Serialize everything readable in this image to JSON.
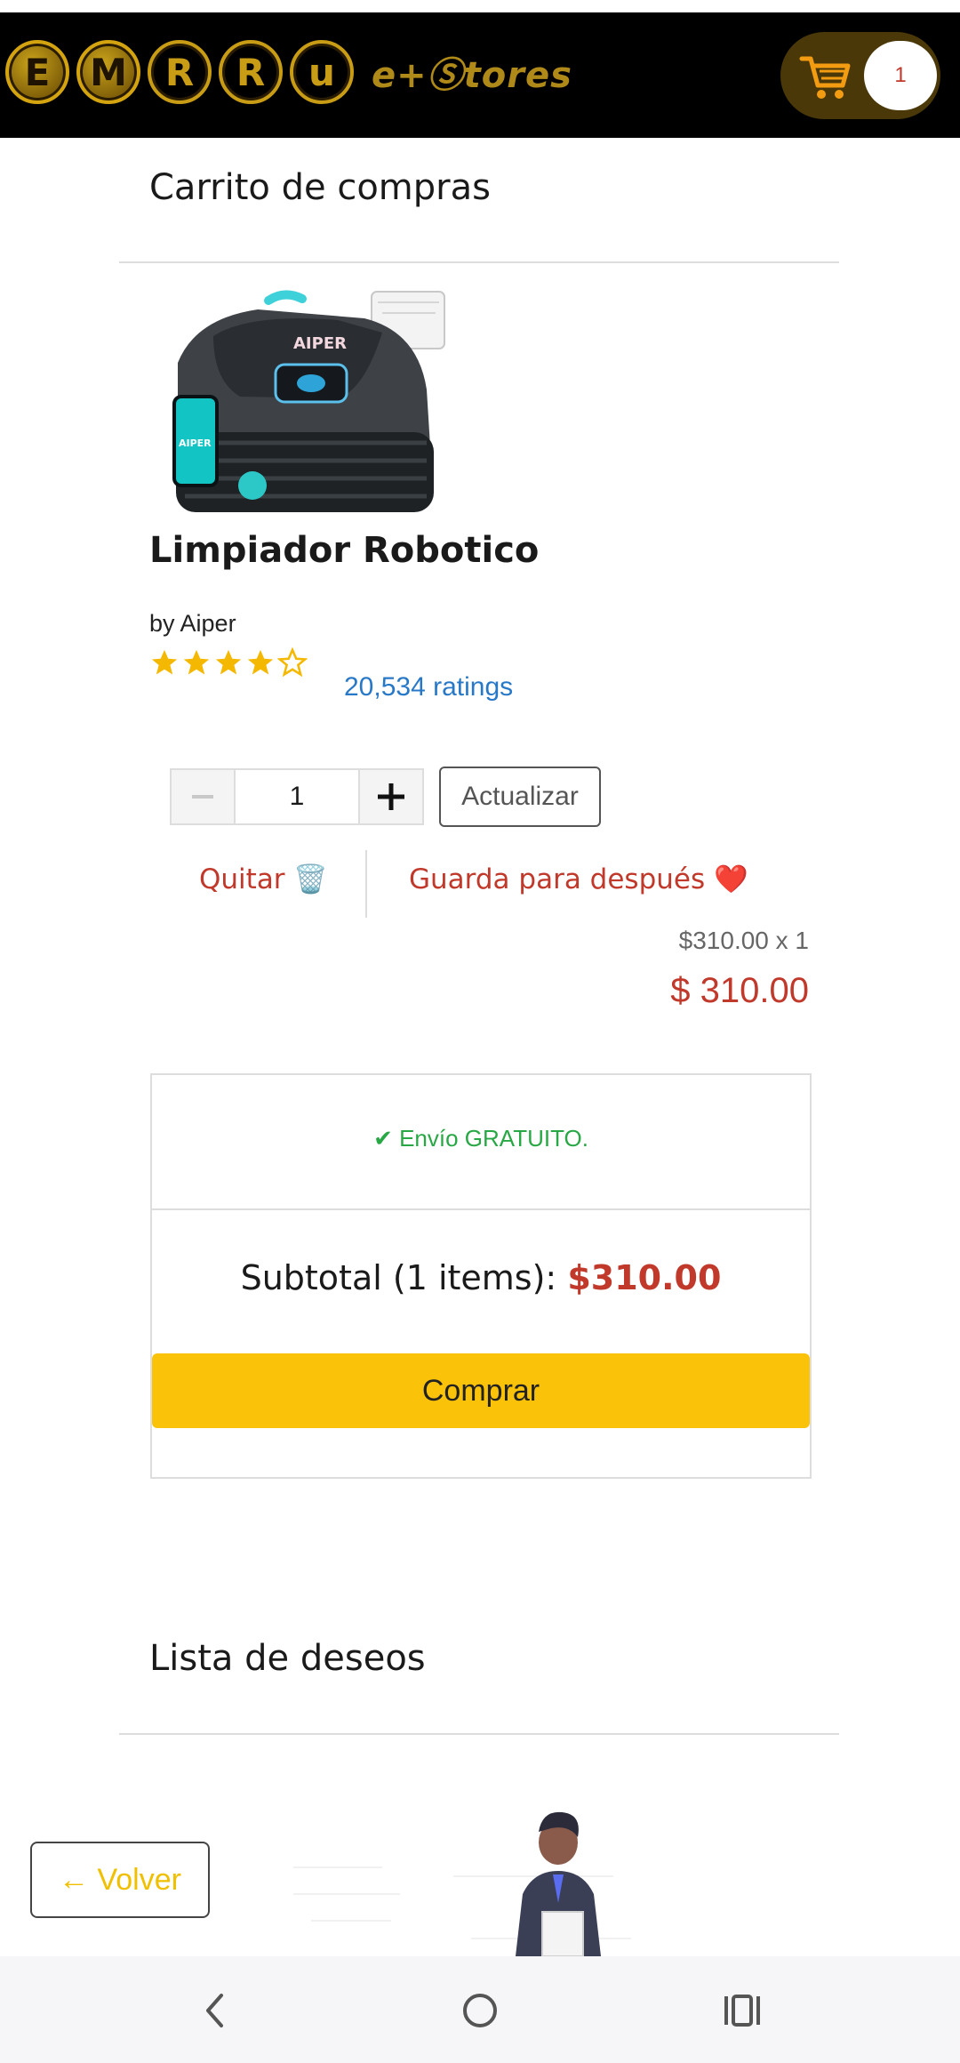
{
  "header": {
    "logo_letters": [
      "E",
      "M",
      "R",
      "R",
      "u"
    ],
    "logo_text": "e+Ⓢtores",
    "cart_count": "1",
    "brand_color": "#c9a21a"
  },
  "cart": {
    "title": "Carrito de compras",
    "product": {
      "name": "Limpiador Robotico",
      "brand": "by Aiper",
      "rating": 4,
      "rating_max": 5,
      "ratings_count": "20,534 ratings",
      "quantity": "1",
      "update_label": "Actualizar",
      "remove_label": "Quitar 🗑️",
      "save_later_label": "Guarda para después ❤️",
      "unit_price_line": "$310.00 x 1",
      "total_price": "$ 310.00"
    },
    "summary": {
      "free_shipping": "✔ Envío GRATUITO.",
      "subtotal_label": "Subtotal (1 items):",
      "subtotal_amount": "$310.00",
      "buy_label": "Comprar"
    }
  },
  "wishlist": {
    "title": "Lista de deseos",
    "back_label": "← Volver"
  },
  "colors": {
    "accent_red": "#c0392b",
    "buy_yellow": "#fbc20a",
    "link_blue": "#2878c8",
    "success_green": "#28a745"
  },
  "nav": {
    "icons": [
      "back-icon",
      "home-icon",
      "recents-icon"
    ]
  }
}
